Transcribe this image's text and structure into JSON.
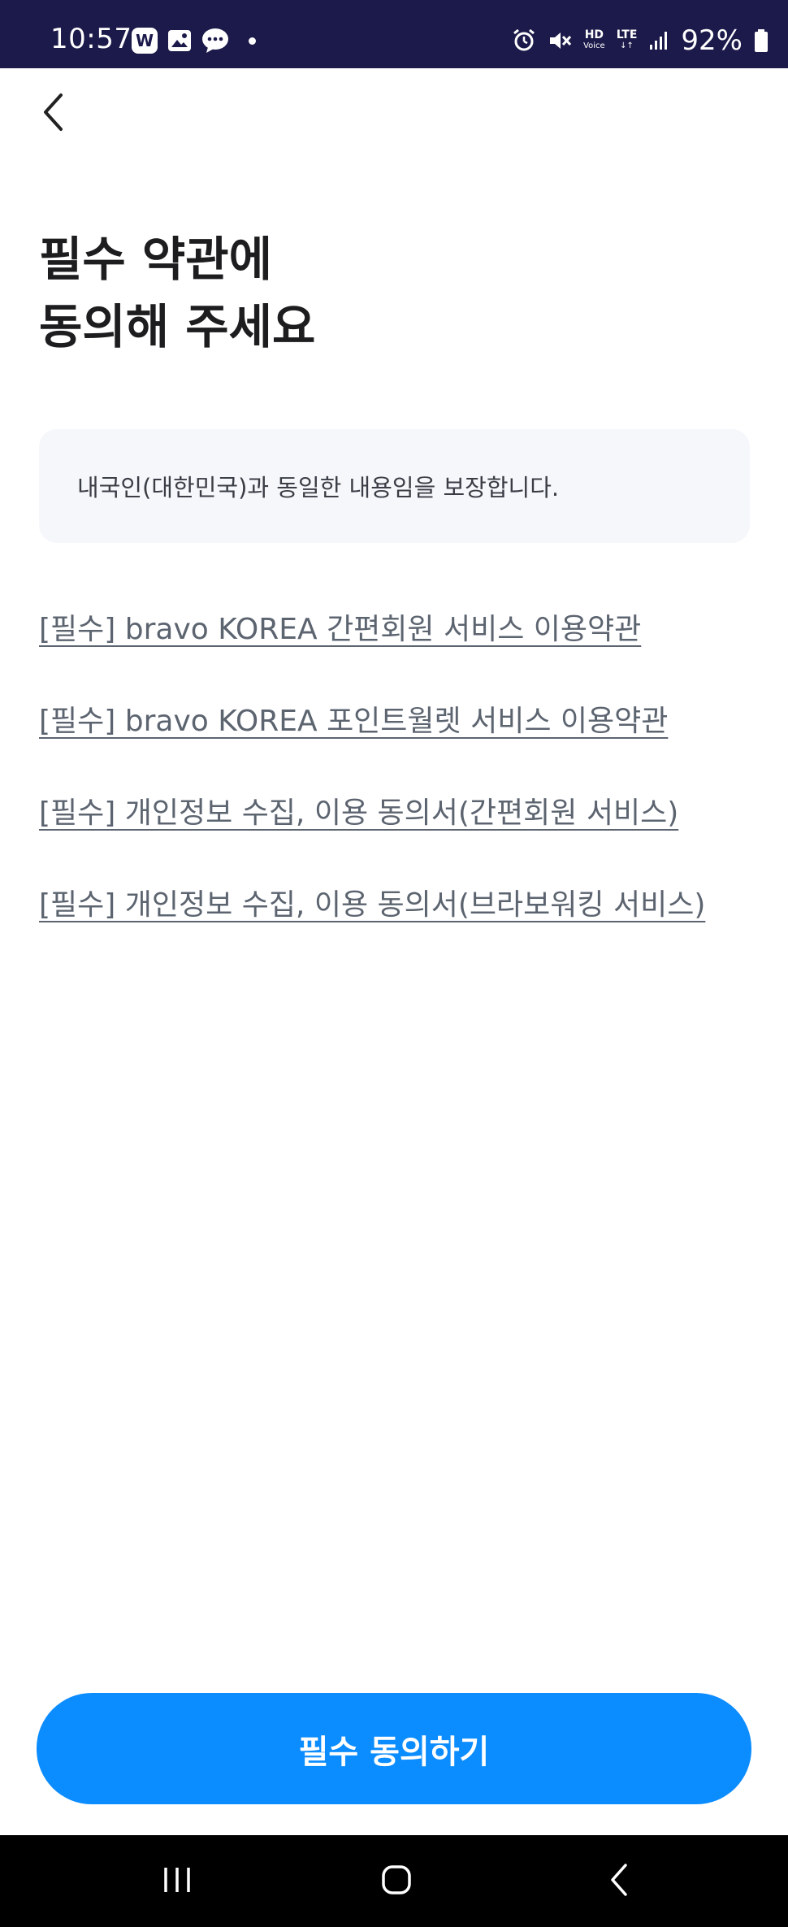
{
  "status_bar": {
    "time": "10:57",
    "app_badge": "W",
    "network_hd": "HD",
    "network_voice": "Voice",
    "network_lte": "LTE",
    "battery": "92%"
  },
  "header": {
    "title_bold": "필수 약관에",
    "title_regular": "동의해 주세요"
  },
  "notice": {
    "text": "내국인(대한민국)과 동일한 내용임을 보장합니다."
  },
  "terms": [
    {
      "label": "[필수] bravo KOREA 간편회원 서비스 이용약관"
    },
    {
      "label": "[필수] bravo KOREA 포인트월렛 서비스 이용약관"
    },
    {
      "label": "[필수] 개인정보 수집, 이용 동의서(간편회원 서비스)"
    },
    {
      "label": "[필수] 개인정보 수집, 이용 동의서(브라보워킹 서비스)"
    }
  ],
  "actions": {
    "agree_label": "필수 동의하기"
  },
  "colors": {
    "status_bar": "#1c1a4a",
    "primary_button": "#0b8cff",
    "notice_bg": "#f6f7fb",
    "link_text": "#5c6470"
  }
}
